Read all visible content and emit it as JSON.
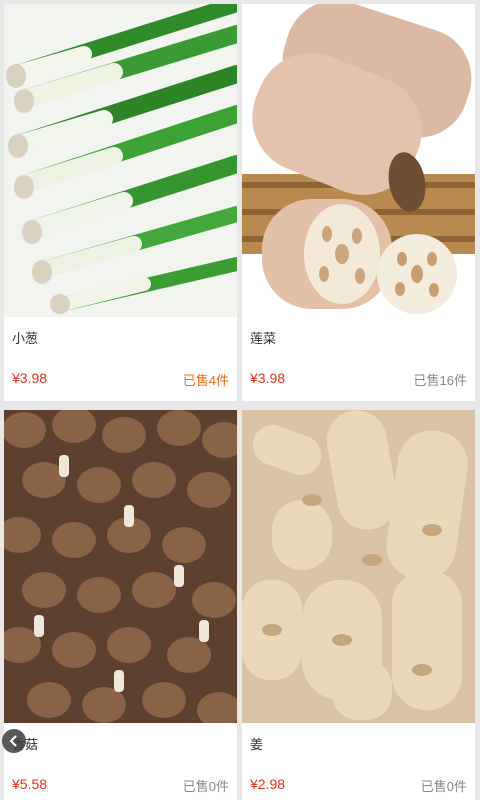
{
  "products": [
    {
      "name": "小葱",
      "price": "¥3.98",
      "sold": "已售4件"
    },
    {
      "name": "莲菜",
      "price": "¥3.98",
      "sold": "已售16件"
    },
    {
      "name": "香菇",
      "price": "¥5.58",
      "sold": "已售0件"
    },
    {
      "name": "姜",
      "price": "¥2.98",
      "sold": "已售0件"
    }
  ],
  "colors": {
    "price": "#e8321e",
    "sold_highlight": "#f26a1b",
    "sold_normal": "#888888"
  },
  "icons": {
    "overlay_button": "chevron-left-icon"
  }
}
